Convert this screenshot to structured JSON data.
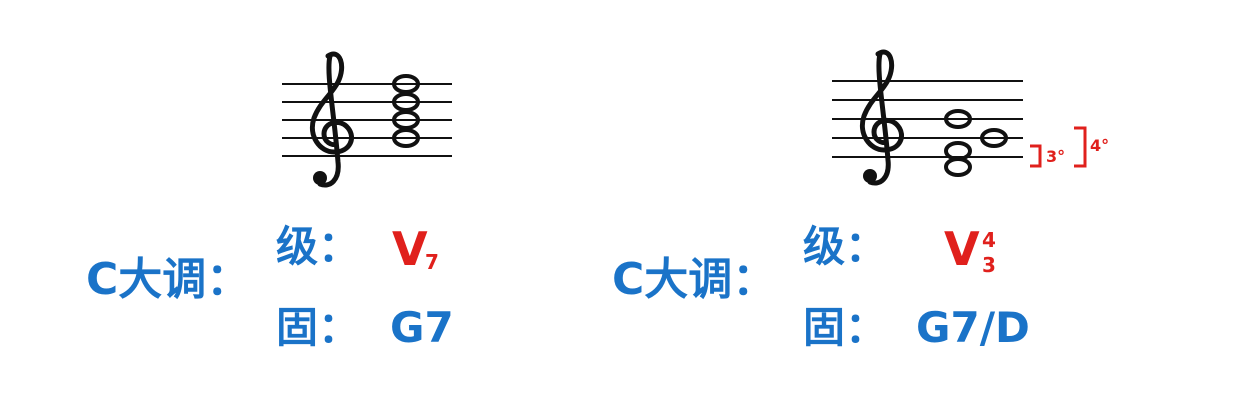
{
  "examples": [
    {
      "key_label": "C大调：",
      "degree_label": "级：",
      "degree": {
        "numeral": "V",
        "figure": "7"
      },
      "root_label": "固：",
      "chord": "G7"
    },
    {
      "key_label": "C大调：",
      "degree_label": "级：",
      "degree": {
        "numeral": "V",
        "figure_top": "4",
        "figure_bottom": "3"
      },
      "root_label": "固：",
      "chord": "G7/D",
      "intervals": {
        "lower": "3°",
        "upper": "4°"
      }
    }
  ],
  "colors": {
    "blue": "#1a73c8",
    "red": "#e0201c",
    "ink": "#111111"
  }
}
